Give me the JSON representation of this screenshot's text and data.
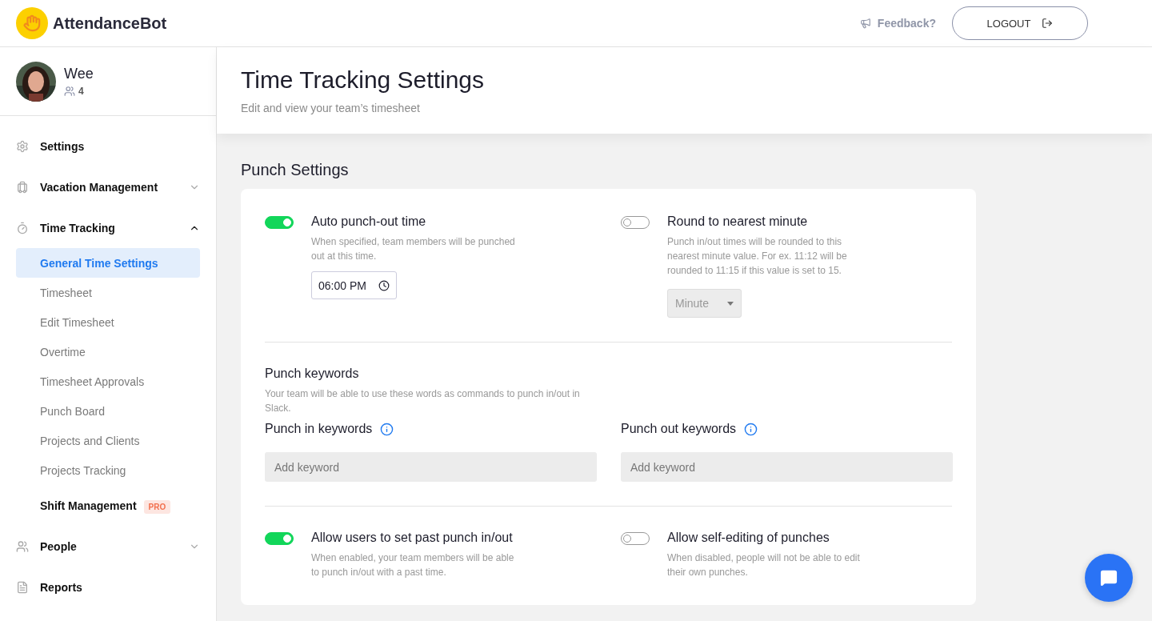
{
  "header": {
    "brand": "AttendanceBot",
    "feedback": "Feedback?",
    "logout": "LOGOUT"
  },
  "user": {
    "name": "Wee",
    "team_count": "4"
  },
  "sidebar": {
    "items": [
      {
        "label": "Settings"
      },
      {
        "label": "Vacation Management",
        "expanded": false
      },
      {
        "label": "Time Tracking",
        "expanded": true,
        "children": [
          {
            "label": "General Time Settings",
            "selected": true
          },
          {
            "label": "Timesheet",
            "selected": false
          },
          {
            "label": "Edit Timesheet",
            "selected": false
          },
          {
            "label": "Overtime",
            "selected": false
          },
          {
            "label": "Timesheet Approvals",
            "selected": false
          },
          {
            "label": "Punch Board",
            "selected": false
          },
          {
            "label": "Projects and Clients",
            "selected": false
          },
          {
            "label": "Projects Tracking",
            "selected": false
          }
        ]
      },
      {
        "label": "Shift Management",
        "badge": "PRO"
      },
      {
        "label": "People",
        "expanded": false
      },
      {
        "label": "Reports"
      }
    ]
  },
  "page": {
    "title": "Time Tracking Settings",
    "subtitle": "Edit and view your team’s timesheet"
  },
  "section": {
    "title": "Punch Settings",
    "top_settings": [
      {
        "label": "Auto punch-out time",
        "on": true,
        "description": "When specified, team members will be punched out at this time.",
        "control": {
          "kind": "time",
          "value": "06:00 PM"
        }
      },
      {
        "label": "Round to nearest minute",
        "on": false,
        "description": "Punch in/out times will be rounded to this nearest minute value. For ex. 11:12 will be rounded to 11:15 if this value is set to 15.",
        "control": {
          "kind": "select",
          "value": "Minute",
          "disabled": true
        }
      }
    ],
    "keywords": {
      "title": "Punch keywords",
      "description": "Your team will be able to use these words as commands to punch in/out in Slack.",
      "fields": [
        {
          "label": "Punch in keywords",
          "placeholder": "Add keyword"
        },
        {
          "label": "Punch out keywords",
          "placeholder": "Add keyword"
        }
      ]
    },
    "bottom_settings": [
      {
        "label": "Allow users to set past punch in/out",
        "on": true,
        "description": "When enabled, your team members will be able to punch in/out with a past time."
      },
      {
        "label": "Allow self-editing of punches",
        "on": false,
        "description": "When disabled, people will not be able to edit their own punches."
      }
    ]
  }
}
